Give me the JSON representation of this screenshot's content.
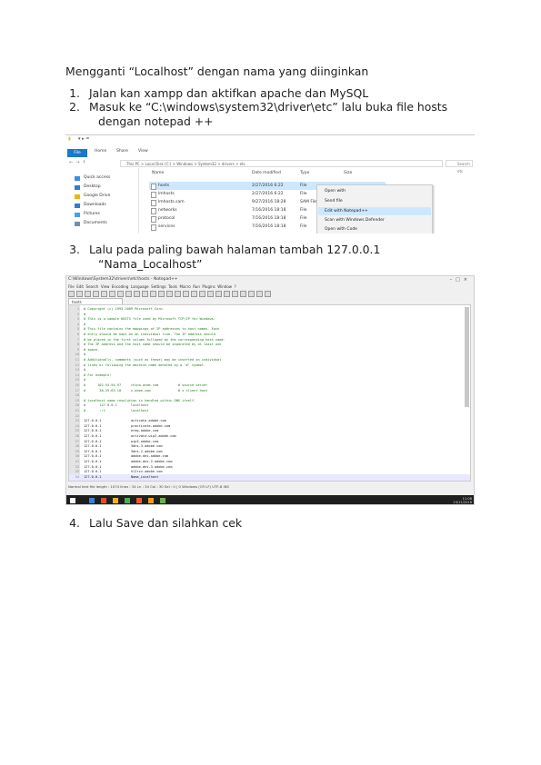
{
  "document": {
    "title": "Mengganti “Localhost” dengan nama yang diinginkan",
    "steps": [
      {
        "number": "1.",
        "lines": [
          "Jalan kan xampp dan aktifkan apache dan MySQL"
        ]
      },
      {
        "number": "2.",
        "lines": [
          "Masuk ke “C:\\windows\\system32\\driver\\etc” lalu buka file hosts",
          "dengan notepad ++"
        ]
      },
      {
        "number": "3.",
        "lines": [
          "Lalu pada paling bawah halaman tambah 127.0.0.1",
          "“Nama_Localhost”"
        ]
      },
      {
        "number": "4.",
        "lines": [
          "Lalu Save dan silahkan cek"
        ]
      }
    ]
  },
  "explorer": {
    "ribbon_tabs": [
      "File",
      "Home",
      "Share",
      "View"
    ],
    "address": "This PC  >  Local Disk (C:)  >  Windows  >  System32  >  drivers  >  etc",
    "search_placeholder": "Search etc",
    "sidebar": [
      "Quick access",
      "Desktop",
      "Google Drive",
      "Downloads",
      "Pictures",
      "Documents"
    ],
    "columns": [
      "Name",
      "Date modified",
      "Type",
      "Size"
    ],
    "files": [
      {
        "name": "hosts",
        "date": "2/27/2016 6:22",
        "type": "File",
        "selected": true
      },
      {
        "name": "lmhosts",
        "date": "2/27/2016 6:22",
        "type": "File",
        "selected": false
      },
      {
        "name": "lmhosts.sam",
        "date": "9/27/2016 18:28",
        "type": "SAM File",
        "selected": false
      },
      {
        "name": "networks",
        "date": "7/16/2016 18:18",
        "type": "File",
        "selected": false
      },
      {
        "name": "protocol",
        "date": "7/16/2016 18:18",
        "type": "File",
        "selected": false
      },
      {
        "name": "services",
        "date": "7/16/2016 18:18",
        "type": "File",
        "selected": false
      }
    ],
    "context_menu": [
      "Open with",
      "Send file",
      "Edit with Notepad++",
      "Scan with Windows Defender",
      "Open with Code"
    ],
    "context_highlight_index": 2,
    "selection_color": "#cce8ff",
    "file_tab_color": "#1979ca"
  },
  "notepad": {
    "window_title": "C:\\Windows\\System32\\drivers\\etc\\hosts - Notepad++",
    "menu": [
      "File",
      "Edit",
      "Search",
      "View",
      "Encoding",
      "Language",
      "Settings",
      "Tools",
      "Macro",
      "Run",
      "Plugins",
      "Window",
      "?"
    ],
    "tab": "hosts",
    "lines": [
      {
        "n": "1",
        "t": "# Copyright (c) 1993-2009 Microsoft Corp.",
        "code": false
      },
      {
        "n": "2",
        "t": "#",
        "code": false
      },
      {
        "n": "3",
        "t": "# This is a sample HOSTS file used by Microsoft TCP/IP for Windows.",
        "code": false
      },
      {
        "n": "4",
        "t": "#",
        "code": false
      },
      {
        "n": "5",
        "t": "# This file contains the mappings of IP addresses to host names. Each",
        "code": false
      },
      {
        "n": "6",
        "t": "# entry should be kept on an individual line. The IP address should",
        "code": false
      },
      {
        "n": "7",
        "t": "# be placed in the first column followed by the corresponding host name.",
        "code": false
      },
      {
        "n": "8",
        "t": "# The IP address and the host name should be separated by at least one",
        "code": false
      },
      {
        "n": "9",
        "t": "# space.",
        "code": false
      },
      {
        "n": "10",
        "t": "#",
        "code": false
      },
      {
        "n": "11",
        "t": "# Additionally, comments (such as these) may be inserted on individual",
        "code": false
      },
      {
        "n": "12",
        "t": "# lines or following the machine name denoted by a '#' symbol.",
        "code": false
      },
      {
        "n": "13",
        "t": "#",
        "code": false
      },
      {
        "n": "14",
        "t": "# For example:",
        "code": false
      },
      {
        "n": "15",
        "t": "#",
        "code": false
      },
      {
        "n": "16",
        "t": "#      102.54.94.97     rhino.acme.com          # source server",
        "code": false
      },
      {
        "n": "17",
        "t": "#       38.25.63.10     x.acme.com              # x client host",
        "code": false
      },
      {
        "n": "18",
        "t": "",
        "code": false
      },
      {
        "n": "19",
        "t": "# localhost name resolution is handled within DNS itself.",
        "code": false
      },
      {
        "n": "20",
        "t": "#\t127.0.0.1       localhost",
        "code": false
      },
      {
        "n": "21",
        "t": "#\t::1             localhost",
        "code": false
      },
      {
        "n": "22",
        "t": "",
        "code": false
      },
      {
        "n": "23",
        "t": "127.0.0.1\t\tactivate.adobe.com",
        "code": true
      },
      {
        "n": "24",
        "t": "127.0.0.1\t\tpractivate.adobe.com",
        "code": true
      },
      {
        "n": "25",
        "t": "127.0.0.1\t\tereg.adobe.com",
        "code": true
      },
      {
        "n": "26",
        "t": "127.0.0.1\t\tactivate.wip3.adobe.com",
        "code": true
      },
      {
        "n": "27",
        "t": "127.0.0.1\t\twip3.adobe.com",
        "code": true
      },
      {
        "n": "28",
        "t": "127.0.0.1\t\t3dns-3.adobe.com",
        "code": true
      },
      {
        "n": "29",
        "t": "127.0.0.1\t\t3dns-2.adobe.com",
        "code": true
      },
      {
        "n": "30",
        "t": "127.0.0.1\t\tadobe-dns.adobe.com",
        "code": true
      },
      {
        "n": "31",
        "t": "127.0.0.1\t\tadobe-dns-2.adobe.com",
        "code": true
      },
      {
        "n": "32",
        "t": "127.0.0.1\t\tadobe-dns-3.adobe.com",
        "code": true
      },
      {
        "n": "33",
        "t": "127.0.0.1\t\thl2rcv.adobe.com",
        "code": true
      },
      {
        "n": "34",
        "t": "127.0.0.1\t\tNama_Localhost",
        "code": true
      }
    ],
    "current_line_index": 33,
    "status": "Normal text file          length : 1074   lines : 34          Ln : 34   Col : 30   Sel : 0 | 0          Windows (CR LF)   UTF-8   INS",
    "tray_time": "11:08",
    "tray_date": "13/11/2016",
    "taskbar_colors": [
      "#ffffff",
      "#3b7fd8",
      "#e34c26",
      "#f2b21b",
      "#4caf50",
      "#e95b2c",
      "#f39c12",
      "#6ab04c"
    ]
  }
}
